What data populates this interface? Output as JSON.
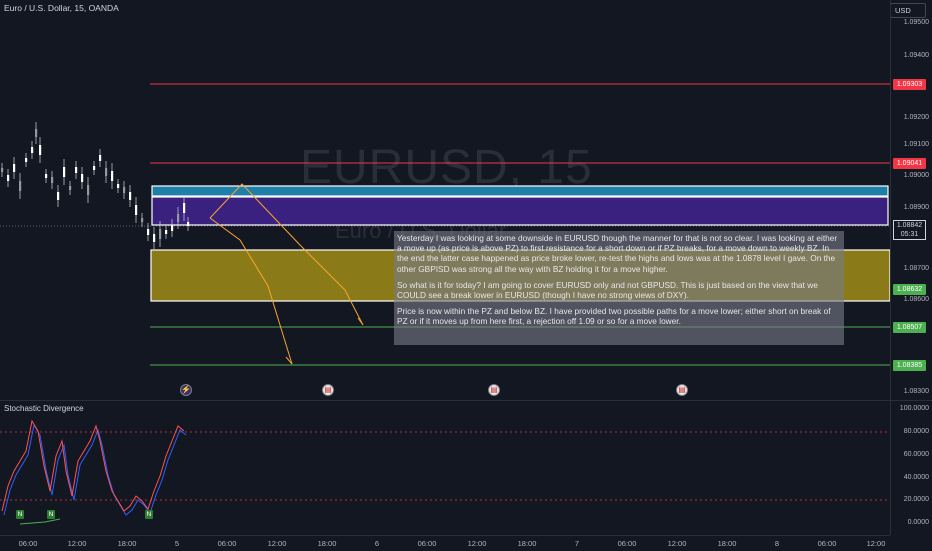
{
  "header": {
    "symbol": "Euro / U.S. Dollar, 15, OANDA",
    "currency_button": "USD"
  },
  "watermark": {
    "ticker": "EURUSD, 15",
    "name": "Euro / U.S. Dollar"
  },
  "price_axis": {
    "ticks": [
      "1.09500",
      "1.09400",
      "1.09200",
      "1.09100",
      "1.09000",
      "1.08900",
      "1.08700",
      "1.08600",
      "1.08300"
    ],
    "stoch_ticks": [
      "100.0000",
      "80.0000",
      "60.0000",
      "40.0000",
      "20.0000",
      "0.0000"
    ]
  },
  "price_levels": [
    {
      "label": "1.09303",
      "color": "#f23645"
    },
    {
      "label": "1.09041",
      "color": "#f23645"
    },
    {
      "label": "1.08632",
      "color": "#4caf50"
    },
    {
      "label": "1.08507",
      "color": "#4caf50"
    },
    {
      "label": "1.08385",
      "color": "#4caf50"
    }
  ],
  "current_price": {
    "price": "1.08842",
    "countdown": "05:31"
  },
  "time_axis": [
    "06:00",
    "12:00",
    "18:00",
    "5",
    "06:00",
    "12:00",
    "18:00",
    "6",
    "06:00",
    "12:00",
    "18:00",
    "7",
    "06:00",
    "12:00",
    "18:00",
    "8",
    "06:00",
    "12:00"
  ],
  "note": {
    "p1": "Yesterday I was looking at some downside in EURUSD though the manner for that is not so clear. I was looking at either a move up (as price is above PZ) to first resistance for a short down or if PZ breaks, for a move down to weekly BZ. In the end the latter case happened as price broke lower, re-test the highs and lows was at the 1.0878 level I gave. On the other GBPISD was strong all the way with BZ holding it for a move higher.",
    "p2": "So what is it for today? I am going to cover EURUSD only and not GBPUSD. This is just based on the view that we COULD see a break lower in EURUSD (though I have no strong views of DXY).",
    "p3": "Price is now within the PZ and below BZ. I have provided two possible paths for a move lower; either short on break of PZ or if it moves up from here first, a rejection off 1.09 or so for a move lower."
  },
  "indicator": {
    "name": "Stochastic Divergence",
    "badge": "N"
  },
  "colors": {
    "background": "#131722",
    "zone_blue": "#1e7fa8",
    "zone_purple": "#3a2180",
    "zone_olive": "#8a7b18",
    "arrow": "#f7a531",
    "stoch_line": "#ff5252",
    "stoch_signal": "#2962ff"
  },
  "icons": {
    "event_flash": "lightning-icon",
    "event_flag": "us-flag-icon"
  }
}
